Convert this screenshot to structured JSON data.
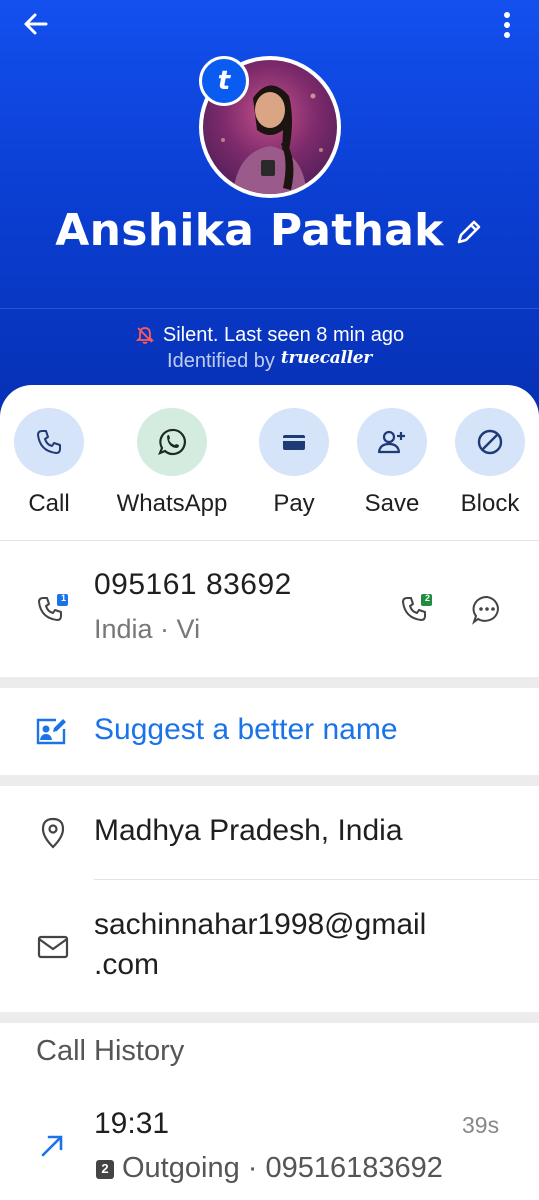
{
  "header": {
    "contact_name": "Anshika Pathak",
    "badge_letter": "t",
    "status": "Silent. Last seen 8 min ago",
    "identified_by": "Identified by",
    "brand": "truecaller"
  },
  "actions": [
    {
      "label": "Call",
      "icon": "phone-icon"
    },
    {
      "label": "WhatsApp",
      "icon": "whatsapp-icon"
    },
    {
      "label": "Pay",
      "icon": "wallet-icon"
    },
    {
      "label": "Save",
      "icon": "add-person-icon"
    },
    {
      "label": "Block",
      "icon": "block-icon"
    }
  ],
  "phone": {
    "number": "095161 83692",
    "sub": "India · Vi",
    "sim1": "1",
    "sim2": "2"
  },
  "suggest": {
    "label": "Suggest a better name"
  },
  "location": {
    "text": "Madhya Pradesh, India"
  },
  "email": {
    "line1": "sachinnahar1998@gmail",
    "line2": ".com"
  },
  "call_history": {
    "title": "Call History",
    "items": [
      {
        "time": "19:31",
        "duration": "39s",
        "sim": "2",
        "detail": "Outgoing · 09516183692"
      }
    ]
  },
  "colors": {
    "header_top": "#1350ee",
    "header_bottom": "#0630b4",
    "accent_blue": "#1a73e8",
    "action_bg": "#d6e4f9",
    "whatsapp_bg": "#d4ece0",
    "muted": "#777777"
  }
}
